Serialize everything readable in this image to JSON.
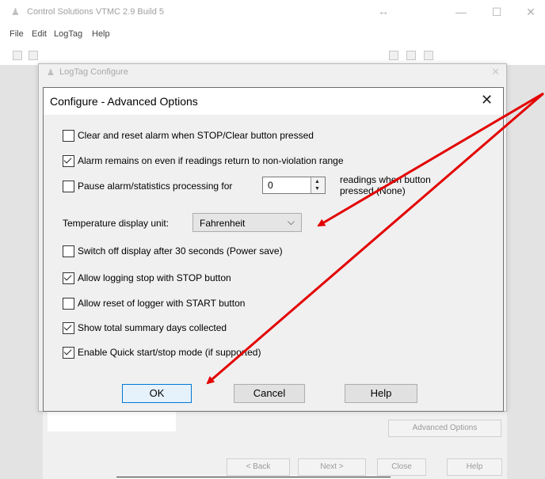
{
  "app": {
    "title": "Control Solutions VTMC 2.9 Build 5",
    "menu": [
      "File",
      "Edit",
      "LogTag",
      "Help"
    ],
    "resize_glyph": "↔",
    "minimize": "—",
    "maximize": "☐",
    "close": "✕"
  },
  "outer_window": {
    "title": "LogTag Configure",
    "close": "✕"
  },
  "background_buttons": {
    "advanced": "Advanced Options",
    "back": "< Back",
    "next": "Next >",
    "close": "Close",
    "help": "Help"
  },
  "dialog": {
    "title": "Configure - Advanced Options",
    "close": "✕",
    "options": [
      {
        "label": "Clear and reset alarm when STOP/Clear button pressed",
        "checked": false
      },
      {
        "label": "Alarm remains on even if readings return to non-violation range",
        "checked": true
      },
      {
        "label": "Pause alarm/statistics processing for",
        "checked": false
      },
      {
        "label": "Switch off display after 30 seconds (Power save)",
        "checked": false
      },
      {
        "label": "Allow logging stop with STOP button",
        "checked": true
      },
      {
        "label": "Allow reset of logger with START button",
        "checked": false
      },
      {
        "label": "Show total summary days collected",
        "checked": true
      },
      {
        "label": "Enable Quick start/stop mode (if supported)",
        "checked": true
      }
    ],
    "pause_value": "0",
    "pause_suffix_line1": "readings when button",
    "pause_suffix_line2": "pressed (None)",
    "temp_unit_label": "Temperature display unit:",
    "temp_unit_value": "Fahrenheit",
    "buttons": {
      "ok": "OK",
      "cancel": "Cancel",
      "help": "Help"
    }
  },
  "colors": {
    "annotation_arrow": "#e30000",
    "ok_focus_border": "#0078d7"
  },
  "icons": [
    "logtag-app-icon",
    "chevron-down-icon",
    "spin-up-icon",
    "spin-down-icon",
    "close-icon",
    "checkmark-icon"
  ]
}
